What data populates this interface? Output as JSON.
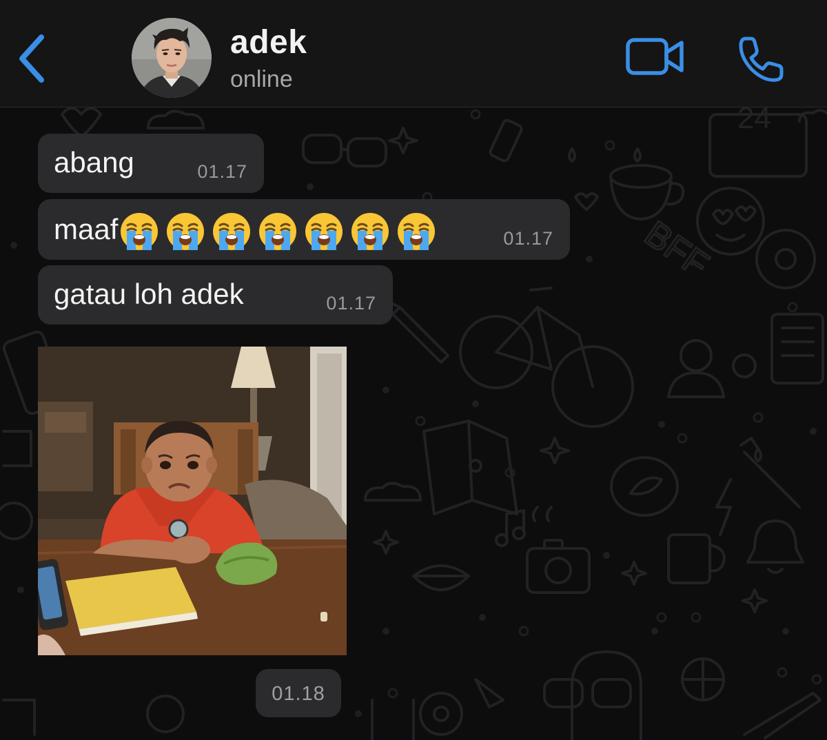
{
  "header": {
    "back_icon": "chevron-left-icon",
    "contact_name": "adek",
    "status": "online",
    "video_icon": "video-camera-icon",
    "call_icon": "phone-icon",
    "accent_color": "#3a8ee6"
  },
  "messages": [
    {
      "text": "abang",
      "time": "01.17"
    },
    {
      "text": "maaf",
      "emoji": "loudly-crying-face",
      "emoji_count": 7,
      "time": "01.17"
    },
    {
      "text": "gatau loh adek",
      "time": "01.17"
    }
  ],
  "image_message": {
    "type": "photo",
    "icon": "image-sticker"
  },
  "last_time": "01.18",
  "colors": {
    "header_bg": "#151515",
    "chat_bg": "#0d0d0e",
    "bubble_bg": "#2b2b2d",
    "text": "#f4f4f4",
    "time_text": "#9a9a9a"
  }
}
